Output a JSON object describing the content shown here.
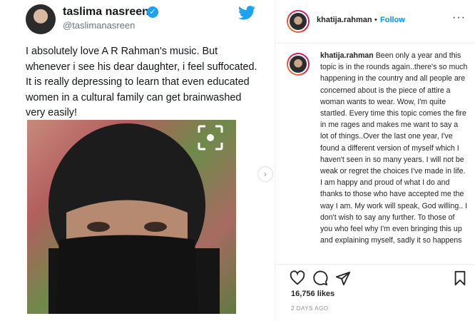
{
  "tweet": {
    "name": "taslima nasreen",
    "handle": "@taslimanasreen",
    "text": "I absolutely love A R Rahman's music. But whenever i see his dear daughter, i feel suffocated. It is really depressing to learn that even  educated women in a  cultural family can get brainwashed very easily!",
    "icons": [
      "verified-badge-icon",
      "twitter-bird-icon",
      "scan-icon"
    ]
  },
  "post": {
    "username": "khatija.rahman",
    "separator": "•",
    "follow_label": "Follow",
    "more_icon": "more-options-icon",
    "caption_username": "khatija.rahman",
    "caption_text": "Been only a year and this topic is in the rounds again..there's so much happening in the country and all people are concerned about is the piece of attire a woman wants to wear. Wow, I'm quite startled. Every time this topic comes the fire in me rages and makes me want to say a lot of things..Over the last one year, I've found a different version of myself which I haven't seen in so many years. I will not be weak or regret the choices I've made in life. I am happy and proud of what I do and thanks to those who have accepted me the way I am. My work will speak, God willing.. I don't wish to say any further. To those of you who feel why I'm even bringing this up and explaining myself, sadly it so happens",
    "likes": "16,756 likes",
    "date": "2 DAYS AGO",
    "icons": [
      "heart-icon",
      "comment-icon",
      "share-icon",
      "bookmark-icon",
      "next-arrow-icon"
    ]
  },
  "colors": {
    "link_blue": "#0095f6",
    "twitter_blue": "#1da1f2",
    "muted": "#8e8e8e"
  }
}
